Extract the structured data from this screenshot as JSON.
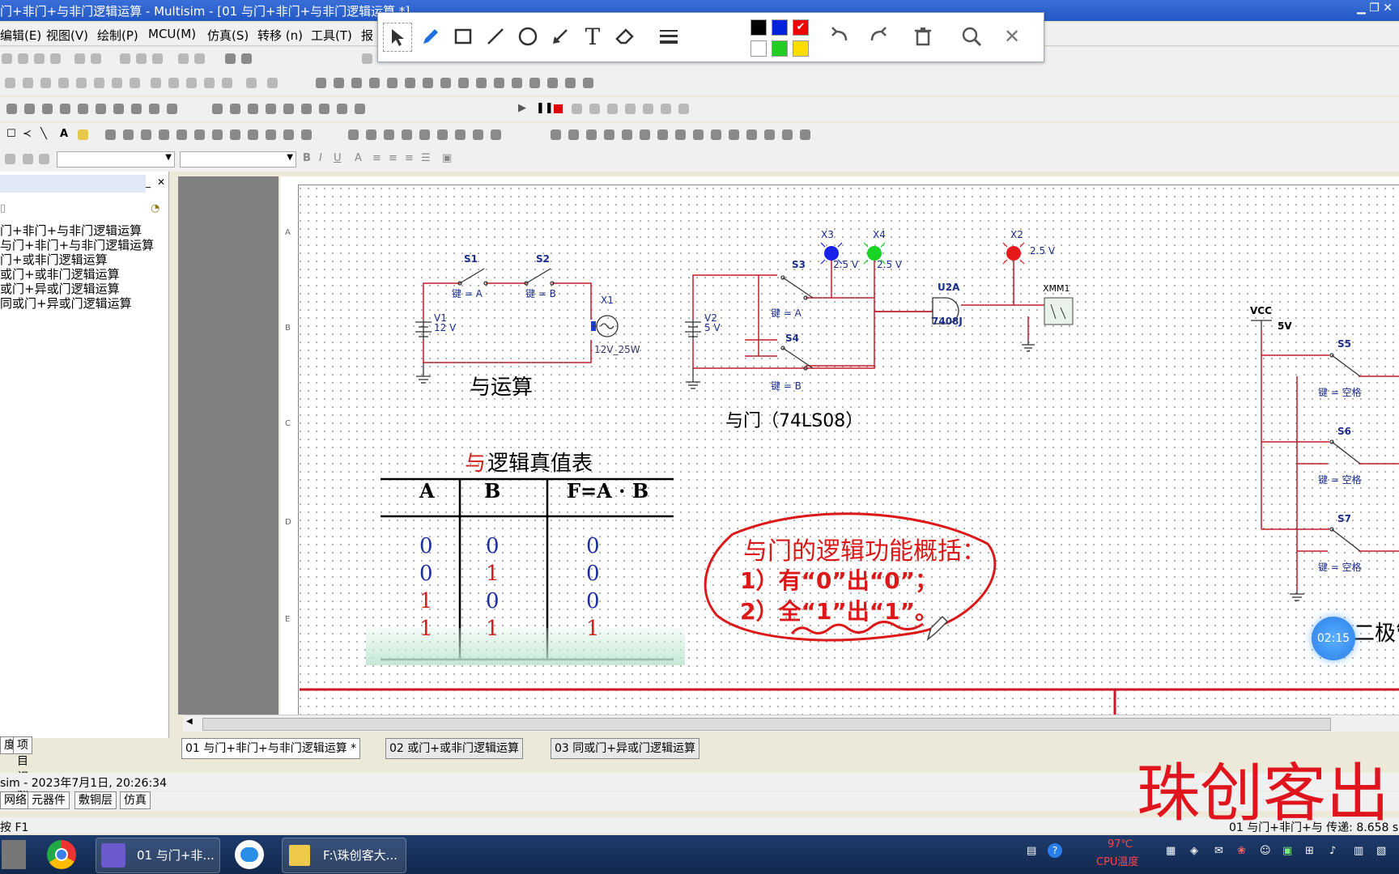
{
  "window": {
    "title": "门+非门+与非门逻辑运算 - Multisim - [01 与门+非门+与非门逻辑运算 *]"
  },
  "menu": [
    "编辑(E)",
    "视图(V)",
    "绘制(P)",
    "MCU(M)",
    "仿真(S)",
    "转移 (n)",
    "工具(T)",
    "报"
  ],
  "annotation_toolbar": {
    "tools": [
      "pointer-icon",
      "pen-icon",
      "rectangle-icon",
      "line-icon",
      "circle-icon",
      "arrow-icon",
      "text-icon",
      "eraser-icon",
      "linewidth-icon",
      "undo-icon",
      "redo-icon",
      "delete-icon",
      "zoom-icon",
      "close-icon"
    ],
    "colors": [
      "#000000",
      "#0022dd",
      "#ee0000",
      "#ffffff",
      "#22cc22",
      "#ffdd00"
    ]
  },
  "left_panel": {
    "items": [
      "门+非门+与非门逻辑运算",
      "与门+非门+与非门逻辑运算",
      "门+或非门逻辑运算",
      "或门+或非门逻辑运算",
      "或门+异或门逻辑运算",
      "同或门+异或门逻辑运算"
    ]
  },
  "ruler": {
    "rows": [
      "A",
      "B",
      "C",
      "D",
      "E"
    ]
  },
  "schematic": {
    "circuit1": {
      "switch1": "S1",
      "switch2": "S2",
      "key1": "键 = A",
      "key2": "键 = B",
      "battery_name": "V1",
      "battery_value": "12 V",
      "lamp_name": "X1",
      "lamp_value": "12V_25W",
      "caption": "与运算"
    },
    "circuit2": {
      "switch3": "S3",
      "switch4": "S4",
      "key3": "键 = A",
      "key4": "键 = B",
      "battery_name": "V2",
      "battery_value": "5 V",
      "probe3": "X3",
      "probe3_value": "2.5 V",
      "probe4": "X4",
      "probe4_value": "2.5 V",
      "probe2": "X2",
      "probe2_value": "2.5 V",
      "gate_name": "U2A",
      "gate_part": "7408J",
      "meter": "XMM1",
      "caption": "与门（74LS08）"
    },
    "circuit3": {
      "vcc_label": "VCC",
      "vcc_value": "5V",
      "s5": "S5",
      "s6": "S6",
      "s7": "S7",
      "key": "键 = 空格",
      "partial_text": "二极管"
    },
    "truth_table": {
      "title_red": "与",
      "title_rest": "逻辑真值表",
      "headers": [
        "A",
        "B",
        "F=A · B"
      ],
      "rows": [
        [
          "0",
          "0",
          "0"
        ],
        [
          "0",
          "1",
          "0"
        ],
        [
          "1",
          "0",
          "0"
        ],
        [
          "1",
          "1",
          "1"
        ]
      ]
    },
    "annotation_note": {
      "line1": "与门的逻辑功能概括：",
      "line2": "1）有“0”出“0”；",
      "line3": "2）全“1”出“1”。"
    },
    "timer": "02:15"
  },
  "doc_tabs": [
    "01 与门+非门+与非门逻辑运算 *",
    "02 或门+或非门逻辑运算",
    "03 同或门+异或门逻辑运算"
  ],
  "status": {
    "log": "sim  -  2023年7月1日, 20:26:34",
    "help": "按 F1",
    "right": "01 与门+非门+与 传递: 8.658 s"
  },
  "bottom_tabs": [
    "网络",
    "元器件",
    "敷铜层",
    "仿真"
  ],
  "left_tabs": [
    "度",
    "项目视图"
  ],
  "watermark": "珠创客出",
  "taskbar": {
    "app1": "01 与门+非...",
    "app2": "F:\\珠创客大...",
    "temp": "97℃",
    "temp_label": "CPU温度"
  }
}
